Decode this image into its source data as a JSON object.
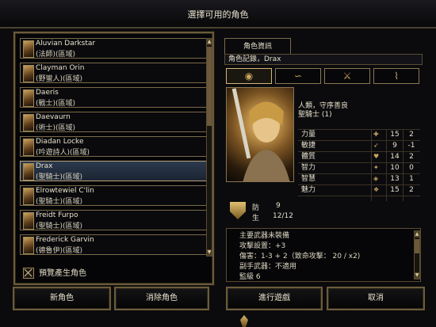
{
  "window": {
    "title": "選擇可用的角色"
  },
  "characters": [
    {
      "name": "Aluvian Darkstar",
      "class": "(法師)(區域)"
    },
    {
      "name": "Clayman Orin",
      "class": "(野蠻人)(區域)"
    },
    {
      "name": "Daeris",
      "class": "(戰士)(區域)"
    },
    {
      "name": "Daevaurn",
      "class": "(術士)(區域)"
    },
    {
      "name": "Diadan Locke",
      "class": "(吟遊詩人)(區域)"
    },
    {
      "name": "Drax",
      "class": "(聖騎士)(區域)",
      "selected": true
    },
    {
      "name": "Elrowtewiel C'lin",
      "class": "(聖騎士)(區域)"
    },
    {
      "name": "Freidt Furpo",
      "class": "(聖騎士)(區域)"
    },
    {
      "name": "Frederick Garvin",
      "class": "(德魯伊)(區域)"
    }
  ],
  "preview_checkbox": {
    "label": "預覽產生角色",
    "checked": true
  },
  "info": {
    "tab_label": "角色資訊",
    "record_title": "角色記錄，Drax",
    "race_alignment": "人類，守序善良",
    "class_level": "聖騎士 (1)",
    "stats": [
      {
        "label": "力量",
        "icon": "strength-icon",
        "score": "15",
        "mod": "2"
      },
      {
        "label": "敏捷",
        "icon": "dexterity-icon",
        "score": "9",
        "mod": "-1"
      },
      {
        "label": "體質",
        "icon": "constitution-icon",
        "score": "14",
        "mod": "2"
      },
      {
        "label": "智力",
        "icon": "intelligence-icon",
        "score": "10",
        "mod": "0"
      },
      {
        "label": "智慧",
        "icon": "wisdom-icon",
        "score": "13",
        "mod": "1"
      },
      {
        "label": "魅力",
        "icon": "charisma-icon",
        "score": "15",
        "mod": "2"
      }
    ],
    "defense_label": "防",
    "defense_value": "9",
    "hp_label": "生",
    "hp_value": "12/12",
    "description": [
      "主要武器未裝備",
      "攻擊設置：+3",
      "傷害：1-3 + 2（致命攻擊： 20 / x2)",
      "副手武器：不適用",
      "監級 6"
    ]
  },
  "buttons": {
    "new_character": "新角色",
    "delete_character": "消除角色",
    "play": "進行遊戲",
    "cancel": "取消"
  },
  "colors": {
    "border_gold": "#6b5b3a",
    "selected_row": "#2c3a4e",
    "background": "#0b0b0e"
  }
}
